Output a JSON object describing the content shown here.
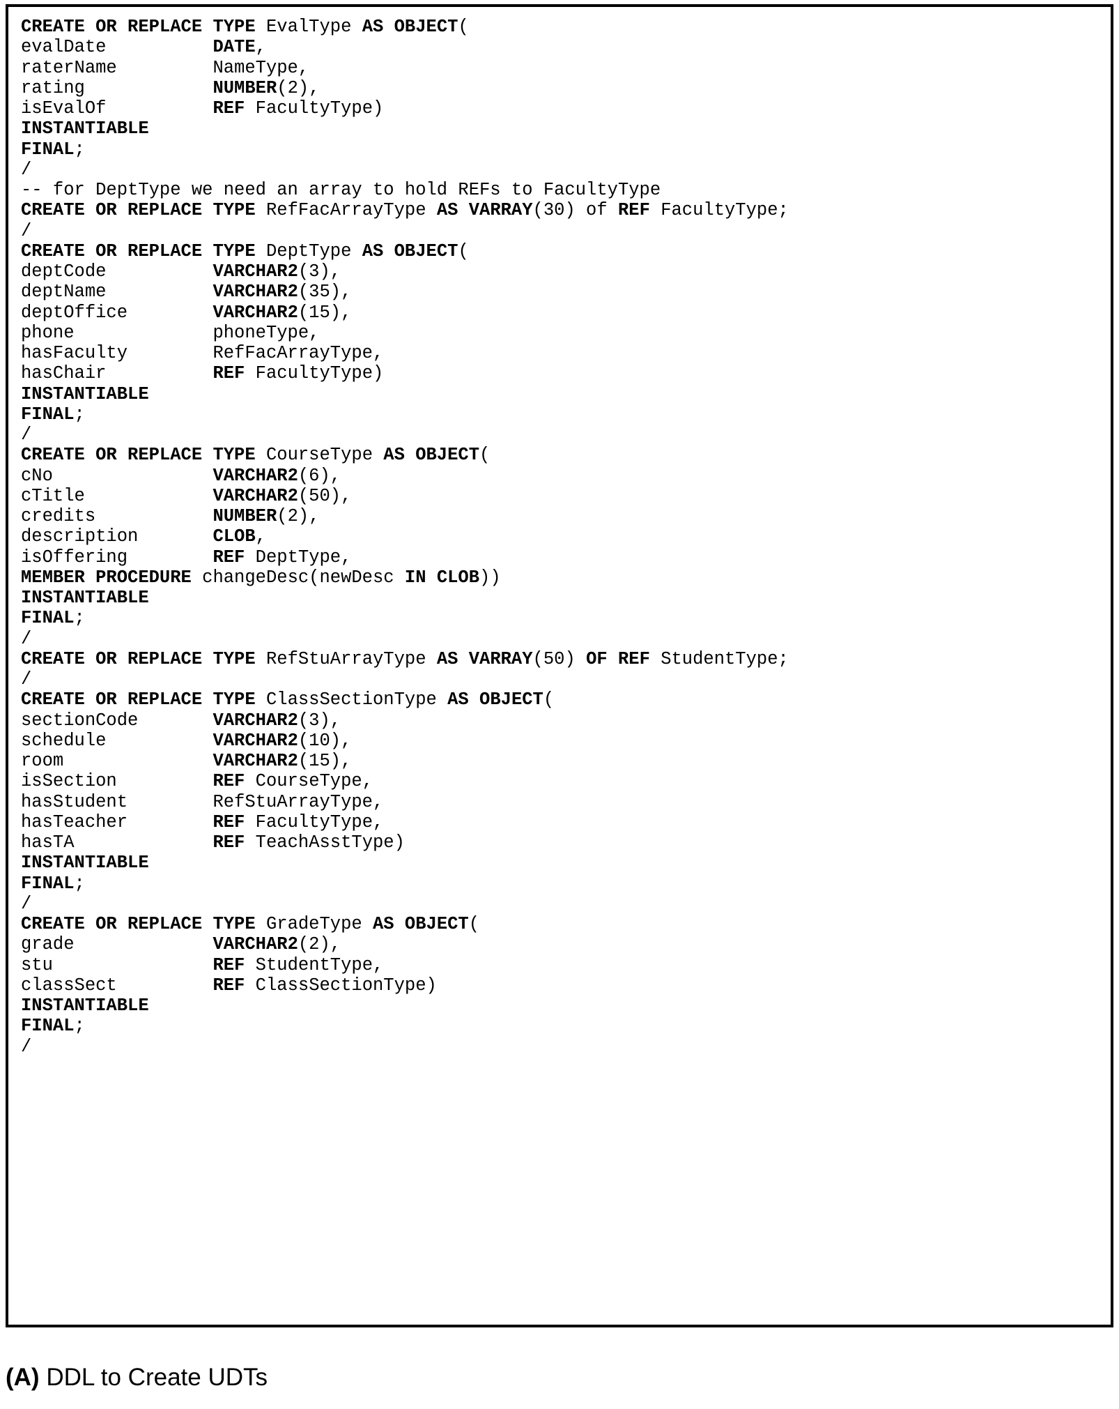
{
  "figure": {
    "caption_label": "(A)",
    "caption_text": " DDL to Create UDTs",
    "border_color": "#000000",
    "background_color": "#ffffff",
    "text_color": "#000000"
  },
  "code": {
    "language": "Oracle SQL DDL",
    "lines": [
      [
        {
          "t": "CREATE OR REPLACE TYPE ",
          "b": true
        },
        {
          "t": "EvalType ",
          "b": false
        },
        {
          "t": "AS OBJECT",
          "b": true
        },
        {
          "t": "(",
          "b": false
        }
      ],
      [
        {
          "t": "evalDate          ",
          "b": false
        },
        {
          "t": "DATE",
          "b": true
        },
        {
          "t": ",",
          "b": false
        }
      ],
      [
        {
          "t": "raterName         NameType,",
          "b": false
        }
      ],
      [
        {
          "t": "rating            ",
          "b": false
        },
        {
          "t": "NUMBER",
          "b": true
        },
        {
          "t": "(2),",
          "b": false
        }
      ],
      [
        {
          "t": "isEvalOf          ",
          "b": false
        },
        {
          "t": "REF",
          "b": true
        },
        {
          "t": " FacultyType)",
          "b": false
        }
      ],
      [
        {
          "t": "INSTANTIABLE",
          "b": true
        }
      ],
      [
        {
          "t": "FINAL",
          "b": true
        },
        {
          "t": ";",
          "b": false
        }
      ],
      [
        {
          "t": "/",
          "b": false
        }
      ],
      [
        {
          "t": "-- for DeptType we need an array to hold REFs to FacultyType",
          "b": false
        }
      ],
      [
        {
          "t": "CREATE OR REPLACE TYPE ",
          "b": true
        },
        {
          "t": "RefFacArrayType ",
          "b": false
        },
        {
          "t": "AS VARRAY",
          "b": true
        },
        {
          "t": "(30) of ",
          "b": false
        },
        {
          "t": "REF",
          "b": true
        },
        {
          "t": " FacultyType;",
          "b": false
        }
      ],
      [
        {
          "t": "/",
          "b": false
        }
      ],
      [
        {
          "t": "CREATE OR REPLACE TYPE ",
          "b": true
        },
        {
          "t": "DeptType ",
          "b": false
        },
        {
          "t": "AS OBJECT",
          "b": true
        },
        {
          "t": "(",
          "b": false
        }
      ],
      [
        {
          "t": "deptCode          ",
          "b": false
        },
        {
          "t": "VARCHAR2",
          "b": true
        },
        {
          "t": "(3),",
          "b": false
        }
      ],
      [
        {
          "t": "deptName          ",
          "b": false
        },
        {
          "t": "VARCHAR2",
          "b": true
        },
        {
          "t": "(35),",
          "b": false
        }
      ],
      [
        {
          "t": "deptOffice        ",
          "b": false
        },
        {
          "t": "VARCHAR2",
          "b": true
        },
        {
          "t": "(15),",
          "b": false
        }
      ],
      [
        {
          "t": "phone             phoneType,",
          "b": false
        }
      ],
      [
        {
          "t": "hasFaculty        RefFacArrayType,",
          "b": false
        }
      ],
      [
        {
          "t": "hasChair          ",
          "b": false
        },
        {
          "t": "REF",
          "b": true
        },
        {
          "t": " FacultyType)",
          "b": false
        }
      ],
      [
        {
          "t": "INSTANTIABLE",
          "b": true
        }
      ],
      [
        {
          "t": "FINAL",
          "b": true
        },
        {
          "t": ";",
          "b": false
        }
      ],
      [
        {
          "t": "/",
          "b": false
        }
      ],
      [
        {
          "t": "CREATE OR REPLACE TYPE ",
          "b": true
        },
        {
          "t": "CourseType ",
          "b": false
        },
        {
          "t": "AS OBJECT",
          "b": true
        },
        {
          "t": "(",
          "b": false
        }
      ],
      [
        {
          "t": "cNo               ",
          "b": false
        },
        {
          "t": "VARCHAR2",
          "b": true
        },
        {
          "t": "(6),",
          "b": false
        }
      ],
      [
        {
          "t": "cTitle            ",
          "b": false
        },
        {
          "t": "VARCHAR2",
          "b": true
        },
        {
          "t": "(50),",
          "b": false
        }
      ],
      [
        {
          "t": "credits           ",
          "b": false
        },
        {
          "t": "NUMBER",
          "b": true
        },
        {
          "t": "(2),",
          "b": false
        }
      ],
      [
        {
          "t": "description       ",
          "b": false
        },
        {
          "t": "CLOB",
          "b": true
        },
        {
          "t": ",",
          "b": false
        }
      ],
      [
        {
          "t": "isOffering        ",
          "b": false
        },
        {
          "t": "REF",
          "b": true
        },
        {
          "t": " DeptType,",
          "b": false
        }
      ],
      [
        {
          "t": "MEMBER PROCEDURE",
          "b": true
        },
        {
          "t": " changeDesc(newDesc ",
          "b": false
        },
        {
          "t": "IN CLOB",
          "b": true
        },
        {
          "t": "))",
          "b": false
        }
      ],
      [
        {
          "t": "INSTANTIABLE",
          "b": true
        }
      ],
      [
        {
          "t": "FINAL",
          "b": true
        },
        {
          "t": ";",
          "b": false
        }
      ],
      [
        {
          "t": "/",
          "b": false
        }
      ],
      [
        {
          "t": "CREATE OR REPLACE TYPE ",
          "b": true
        },
        {
          "t": "RefStuArrayType ",
          "b": false
        },
        {
          "t": "AS VARRAY",
          "b": true
        },
        {
          "t": "(50) ",
          "b": false
        },
        {
          "t": "OF REF",
          "b": true
        },
        {
          "t": " StudentType;",
          "b": false
        }
      ],
      [
        {
          "t": "/",
          "b": false
        }
      ],
      [
        {
          "t": "CREATE OR REPLACE TYPE ",
          "b": true
        },
        {
          "t": "ClassSectionType ",
          "b": false
        },
        {
          "t": "AS OBJECT",
          "b": true
        },
        {
          "t": "(",
          "b": false
        }
      ],
      [
        {
          "t": "sectionCode       ",
          "b": false
        },
        {
          "t": "VARCHAR2",
          "b": true
        },
        {
          "t": "(3),",
          "b": false
        }
      ],
      [
        {
          "t": "schedule          ",
          "b": false
        },
        {
          "t": "VARCHAR2",
          "b": true
        },
        {
          "t": "(10),",
          "b": false
        }
      ],
      [
        {
          "t": "room              ",
          "b": false
        },
        {
          "t": "VARCHAR2",
          "b": true
        },
        {
          "t": "(15),",
          "b": false
        }
      ],
      [
        {
          "t": "isSection         ",
          "b": false
        },
        {
          "t": "REF",
          "b": true
        },
        {
          "t": " CourseType,",
          "b": false
        }
      ],
      [
        {
          "t": "hasStudent        RefStuArrayType,",
          "b": false
        }
      ],
      [
        {
          "t": "hasTeacher        ",
          "b": false
        },
        {
          "t": "REF",
          "b": true
        },
        {
          "t": " FacultyType,",
          "b": false
        }
      ],
      [
        {
          "t": "hasTA             ",
          "b": false
        },
        {
          "t": "REF",
          "b": true
        },
        {
          "t": " TeachAsstType)",
          "b": false
        }
      ],
      [
        {
          "t": "INSTANTIABLE",
          "b": true
        }
      ],
      [
        {
          "t": "FINAL",
          "b": true
        },
        {
          "t": ";",
          "b": false
        }
      ],
      [
        {
          "t": "/",
          "b": false
        }
      ],
      [
        {
          "t": "CREATE OR REPLACE TYPE ",
          "b": true
        },
        {
          "t": "GradeType ",
          "b": false
        },
        {
          "t": "AS OBJECT",
          "b": true
        },
        {
          "t": "(",
          "b": false
        }
      ],
      [
        {
          "t": "grade             ",
          "b": false
        },
        {
          "t": "VARCHAR2",
          "b": true
        },
        {
          "t": "(2),",
          "b": false
        }
      ],
      [
        {
          "t": "stu               ",
          "b": false
        },
        {
          "t": "REF",
          "b": true
        },
        {
          "t": " StudentType,",
          "b": false
        }
      ],
      [
        {
          "t": "classSect         ",
          "b": false
        },
        {
          "t": "REF",
          "b": true
        },
        {
          "t": " ClassSectionType)",
          "b": false
        }
      ],
      [
        {
          "t": "INSTANTIABLE",
          "b": true
        }
      ],
      [
        {
          "t": "FINAL",
          "b": true
        },
        {
          "t": ";",
          "b": false
        }
      ],
      [
        {
          "t": "/",
          "b": false
        }
      ]
    ]
  }
}
